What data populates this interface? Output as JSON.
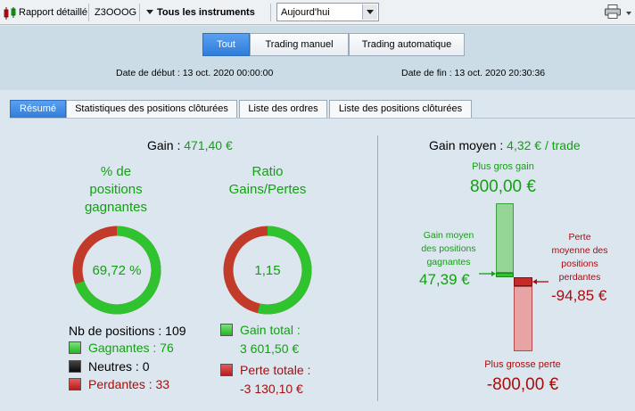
{
  "toolbar": {
    "report_label": "Rapport détaillé",
    "account": "Z3OOOG",
    "instruments": "Tous les instruments",
    "period": "Aujourd'hui"
  },
  "filters": {
    "all": "Tout",
    "manual": "Trading manuel",
    "auto": "Trading automatique",
    "active": "Tout"
  },
  "dates": {
    "start": "Date de début : 13 oct. 2020 00:00:00",
    "end": "Date de fin : 13 oct. 2020 20:30:36"
  },
  "tabs": [
    {
      "label": "Résumé",
      "active": true
    },
    {
      "label": "Statistiques des positions clôturées",
      "active": false
    },
    {
      "label": "Liste des ordres",
      "active": false
    },
    {
      "label": "Liste des positions clôturées",
      "active": false
    }
  ],
  "summary": {
    "gain_label": "Gain :",
    "gain_value": "471,40 €",
    "pct_title": [
      "% de",
      "positions",
      "gagnantes"
    ],
    "pct_value": "69,72 %",
    "pct_fraction": 0.6972,
    "ratio_title": [
      "Ratio",
      "Gains/Pertes"
    ],
    "ratio_value": "1,15",
    "ratio_fraction": 0.535,
    "count_label": "Nb de positions : 109",
    "winning": "Gagnantes : 76",
    "neutral": "Neutres : 0",
    "losing": "Perdantes : 33",
    "total_gain_label": "Gain total :",
    "total_gain_value": "3 601,50 €",
    "total_loss_label": "Perte totale :",
    "total_loss_value": "-3 130,10 €"
  },
  "average": {
    "label": "Gain moyen :",
    "value": "4,32 € / trade",
    "max_gain_label": "Plus gros gain",
    "max_gain_value": "800,00 €",
    "avg_win_label": [
      "Gain moyen",
      "des positions",
      "gagnantes"
    ],
    "avg_win_value": "47,39 €",
    "avg_loss_label": [
      "Perte",
      "moyenne des",
      "positions",
      "perdantes"
    ],
    "avg_loss_value": "-94,85 €",
    "max_loss_label": "Plus grosse perte",
    "max_loss_value": "-800,00 €"
  },
  "colors": {
    "green": "#13a013",
    "red": "#a80d0d",
    "accent": "#2f7ddb"
  }
}
